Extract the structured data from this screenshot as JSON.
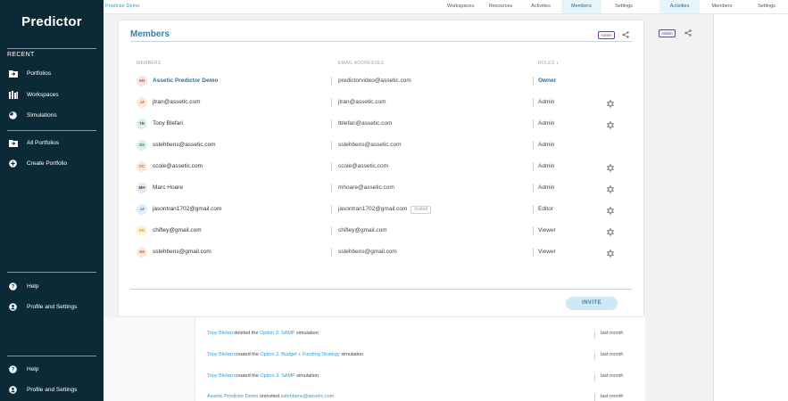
{
  "app": {
    "logo": "Predictor",
    "breadcrumb": "Predictor Demo"
  },
  "sidebar": {
    "recent_label": "RECENT",
    "recent_items": [
      {
        "label": "Portfolios",
        "icon": "folder-icon"
      },
      {
        "label": "Workspaces",
        "icon": "workspace-icon"
      },
      {
        "label": "Simulations",
        "icon": "simulation-icon"
      }
    ],
    "actions": [
      {
        "label": "All Portfolios",
        "icon": "folder-icon"
      },
      {
        "label": "Create Portfolio",
        "icon": "plus-circle-icon"
      }
    ],
    "bottom": [
      {
        "label": "Help",
        "icon": "help-icon"
      },
      {
        "label": "Profile and Settings",
        "icon": "user-icon"
      }
    ],
    "bottom2": [
      {
        "label": "Help",
        "icon": "help-icon"
      },
      {
        "label": "Profile and Settings",
        "icon": "user-icon"
      }
    ]
  },
  "topnav": {
    "tabs": [
      {
        "label": "Workspaces",
        "active": false
      },
      {
        "label": "Resources",
        "active": false
      },
      {
        "label": "Activities",
        "active": false
      },
      {
        "label": "Members",
        "active": true
      },
      {
        "label": "Settings",
        "active": false
      }
    ]
  },
  "right_panel": {
    "tabs": [
      {
        "label": "Activities",
        "active": true
      },
      {
        "label": "Members",
        "active": false
      },
      {
        "label": "Settings",
        "active": false
      }
    ],
    "badge": "Admin"
  },
  "members_card": {
    "title": "Members",
    "badge": "Admin",
    "headers": {
      "members": "MEMBERS",
      "emails": "EMAIL ADDRESSES",
      "roles": "ROLES"
    },
    "rows": [
      {
        "initials": "AD",
        "name": "Assetic Predictor Demo",
        "email": "predictorvideo@assetic.com",
        "invited": "",
        "role": "Owner",
        "gear": false,
        "avatar_bg": "#fde4e4",
        "avatar_fg": "#c0392b"
      },
      {
        "initials": "JJ",
        "name": "jtran@assetic.com",
        "email": "jtran@assetic.com",
        "invited": "",
        "role": "Admin",
        "gear": true,
        "avatar_bg": "#fde8dc",
        "avatar_fg": "#d35400"
      },
      {
        "initials": "TB",
        "name": "Tony Blefari",
        "email": "tblefari@assetic.com",
        "invited": "",
        "role": "Admin",
        "gear": true,
        "avatar_bg": "#e0f0e0",
        "avatar_fg": "#2e7d32"
      },
      {
        "initials": "SS",
        "name": "sstehbens@assetic.com",
        "email": "sstehbens@assetic.com",
        "invited": "",
        "role": "Admin",
        "gear": false,
        "avatar_bg": "#dff1ec",
        "avatar_fg": "#1f7a63"
      },
      {
        "initials": "CC",
        "name": "ccole@assetic.com",
        "email": "ccole@assetic.com",
        "invited": "",
        "role": "Admin",
        "gear": true,
        "avatar_bg": "#fde8dc",
        "avatar_fg": "#d35400"
      },
      {
        "initials": "MH",
        "name": "Marc Hoare",
        "email": "mhoare@assetic.com",
        "invited": "",
        "role": "Admin",
        "gear": true,
        "avatar_bg": "#e6e9f2",
        "avatar_fg": "#34495e"
      },
      {
        "initials": "JJ",
        "name": "jasontran1702@gmail.com",
        "email": "jasontran1702@gmail.com",
        "invited": "Invited",
        "role": "Editor",
        "gear": true,
        "avatar_bg": "#e1eefa",
        "avatar_fg": "#2a6f9b"
      },
      {
        "initials": "CC",
        "name": "chifley@gmail.com",
        "email": "chifley@gmail.com",
        "invited": "",
        "role": "Viewer",
        "gear": true,
        "avatar_bg": "#fff5cc",
        "avatar_fg": "#b8860b"
      },
      {
        "initials": "SS",
        "name": "sstehbens@gmail.com",
        "email": "sstehbens@gmail.com",
        "invited": "",
        "role": "Viewer",
        "gear": true,
        "avatar_bg": "#fde8dc",
        "avatar_fg": "#d35400"
      }
    ],
    "invite_label": "INVITE"
  },
  "activity_feed": [
    {
      "actor": "Tony Blefari",
      "verb": "deleted the",
      "target": "Option 3: SAMP",
      "suffix": "simulation",
      "time": "last month"
    },
    {
      "actor": "Tony Blefari",
      "verb": "created the",
      "target": "Option 2: Budget + Funding Strategy",
      "suffix": "simulation",
      "time": "last month"
    },
    {
      "actor": "Tony Blefari",
      "verb": "created the",
      "target": "Option 3: SAMP",
      "suffix": "simulation",
      "time": "last month"
    },
    {
      "actor": "Assetic Predictor Demo",
      "verb": "uninvited",
      "target": "sstehbens@assetic.com",
      "suffix": "",
      "time": "last month"
    }
  ]
}
